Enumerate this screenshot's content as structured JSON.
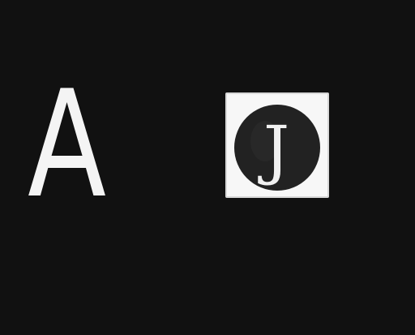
{
  "toolbar": {
    "text_tool_label": "A",
    "j_icon_letter": "J"
  },
  "colors": {
    "background": "#111111",
    "text_tool": "#f4f4f4",
    "icon_tile": "#f7f7f7",
    "icon_circle": "#222222",
    "icon_letter": "#f1f1f1"
  }
}
